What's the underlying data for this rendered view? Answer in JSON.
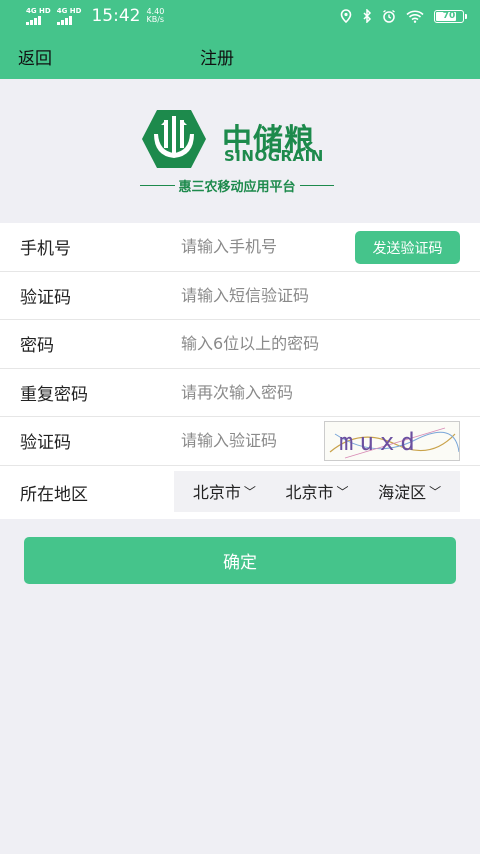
{
  "status": {
    "net1": "4G HD",
    "net2": "4G HD",
    "time": "15:42",
    "speed_value": "4.40",
    "speed_unit": "KB/s",
    "battery": "70"
  },
  "nav": {
    "back_label": "返回",
    "title": "注册"
  },
  "logo": {
    "name_cn": "中储粮",
    "name_en": "SINOGRAIN",
    "slogan": "惠三农移动应用平台"
  },
  "form": {
    "phone_label": "手机号",
    "phone_placeholder": "请输入手机号",
    "send_code_label": "发送验证码",
    "sms_label": "验证码",
    "sms_placeholder": "请输入短信验证码",
    "password_label": "密码",
    "password_placeholder": "输入6位以上的密码",
    "confirm_label": "重复密码",
    "confirm_placeholder": "请再次输入密码",
    "captcha_label": "验证码",
    "captcha_placeholder": "请输入验证码",
    "captcha_text": "muxd",
    "region_label": "所在地区",
    "province": "北京市",
    "city": "北京市",
    "district": "海淀区"
  },
  "confirm_button": "确定",
  "colors": {
    "accent": "#45c48b",
    "brand": "#1d8a4c"
  }
}
